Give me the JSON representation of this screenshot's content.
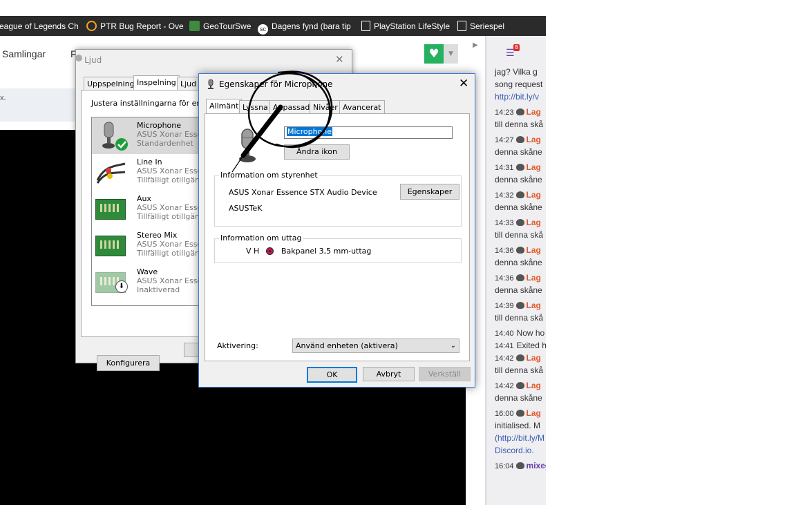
{
  "bookmarks": [
    {
      "label": "eague of Legends Ch",
      "icon": "none"
    },
    {
      "label": "PTR Bug Report - Ove",
      "icon": "overwatch-icon"
    },
    {
      "label": "GeoTourSwe",
      "icon": "geotour-icon"
    },
    {
      "label": "Dagens fynd (bara tip",
      "icon": "dagens-fynd-icon"
    },
    {
      "label": "PlayStation LifeStyle",
      "icon": "page-icon"
    },
    {
      "label": "Seriespel",
      "icon": "page-icon"
    }
  ],
  "browser": {
    "samlingar": "Samlingar",
    "stray_f": "F",
    "gray_text": "x."
  },
  "chat": {
    "badge": "8",
    "lines": [
      {
        "text": "jag? Vilka g"
      },
      {
        "text": "song request"
      },
      {
        "text": "http://bit.ly/v",
        "link": true
      },
      {
        "time": "14:23",
        "name": "Lag"
      },
      {
        "text": "till denna skå"
      },
      {
        "time": "14:27",
        "name": "Lag"
      },
      {
        "text": "denna skåne"
      },
      {
        "time": "14:31",
        "name": "Lag"
      },
      {
        "text": "denna skåne"
      },
      {
        "time": "14:32",
        "name": "Lag"
      },
      {
        "text": "denna skåne"
      },
      {
        "time": "14:33",
        "name": "Lag"
      },
      {
        "text": "till denna skå"
      },
      {
        "time": "14:36",
        "name": "Lag"
      },
      {
        "text": "denna skåne"
      },
      {
        "time": "14:36",
        "name": "Lag"
      },
      {
        "text": "denna skåne"
      },
      {
        "time": "14:39",
        "name": "Lag"
      },
      {
        "text": "till denna skå"
      },
      {
        "time": "14:40",
        "plain": "Now ho"
      },
      {
        "time": "14:41",
        "plain": "Exited h"
      },
      {
        "time": "14:42",
        "name": "Lag"
      },
      {
        "text": "till denna skå"
      },
      {
        "time": "14:42",
        "name": "Lag"
      },
      {
        "text": "denna skåne"
      },
      {
        "time": "16:00",
        "name": "Lag"
      },
      {
        "text": "initialised. M"
      },
      {
        "text": "(http://bit.ly/M",
        "link": true
      },
      {
        "text": "Discord.io.",
        "link": true
      },
      {
        "time": "16:04",
        "name": "mixega",
        "purple": true
      }
    ]
  },
  "ljud": {
    "title": "Ljud",
    "tabs": [
      "Uppspelning",
      "Inspelning",
      "Ljud"
    ],
    "selected_tab": "Inspelning",
    "description": "Justera inställningarna för en i",
    "devices": [
      {
        "name": "Microphone",
        "sub": "ASUS Xonar Essen",
        "status": "Standardenhet",
        "icon": "microphone-icon",
        "default": true
      },
      {
        "name": "Line In",
        "sub": "ASUS Xonar Essen",
        "status": "Tillfälligt otillgäng",
        "icon": "rca-cable-icon"
      },
      {
        "name": "Aux",
        "sub": "ASUS Xonar Essen",
        "status": "Tillfälligt otillgäng",
        "icon": "sound-card-icon"
      },
      {
        "name": "Stereo Mix",
        "sub": "ASUS Xonar Essen",
        "status": "Tillfälligt otillgäng",
        "icon": "sound-card-icon"
      },
      {
        "name": "Wave",
        "sub": "ASUS Xonar Essen",
        "status": "Inaktiverad",
        "icon": "sound-card-icon",
        "disabled": true
      }
    ],
    "configure_label": "Konfigurera"
  },
  "egenskaper": {
    "title": "Egenskaper för Microphone",
    "tabs": [
      "Allmänt",
      "Lyssna",
      "Anpassad",
      "Nivåer",
      "Avancerat"
    ],
    "selected_tab": "Allmänt",
    "device_name": "Microphone",
    "change_icon_label": "Ändra ikon",
    "controller_group": "Information om styrenhet",
    "controller_name": "ASUS Xonar Essence STX Audio Device",
    "controller_vendor": "ASUSTeK",
    "properties_label": "Egenskaper",
    "jack_group": "Information om uttag",
    "jack_side": "V H",
    "jack_label": "Bakpanel 3,5 mm-uttag",
    "jack_color": "#c2185b",
    "activation_label": "Aktivering:",
    "activation_value": "Använd enheten (aktivera)",
    "ok_label": "OK",
    "cancel_label": "Avbryt",
    "apply_label": "Verkställ"
  }
}
